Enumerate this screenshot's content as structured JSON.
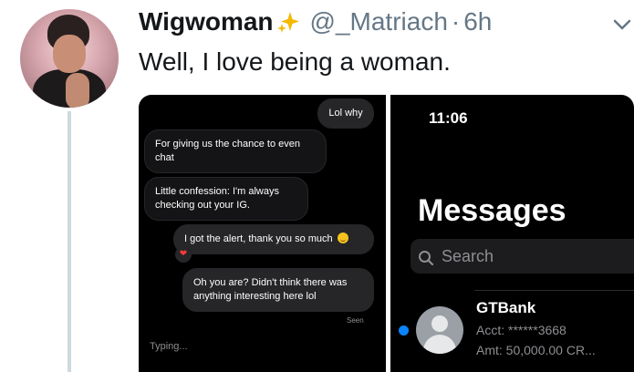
{
  "tweet": {
    "display_name": "Wigwoman",
    "handle": "@_Matriach",
    "separator": "·",
    "time": "6h",
    "text": "Well, I love being a woman."
  },
  "chat_screenshot": {
    "messages": [
      {
        "text": "Lol why",
        "side": "out"
      },
      {
        "text": "For giving us the chance to even chat",
        "side": "in"
      },
      {
        "text": "Little confession:  I'm always checking out your IG.",
        "side": "in"
      },
      {
        "text": "I got the alert, thank you so much",
        "side": "out",
        "emoji": "smile-emoji",
        "reaction": "❤"
      },
      {
        "text": "Oh you are? Didn't think there was anything interesting here lol",
        "side": "out"
      }
    ],
    "seen_label": "Seen",
    "typing_label": "Typing..."
  },
  "messages_screenshot": {
    "status_time": "11:06",
    "title": "Messages",
    "search_placeholder": "Search",
    "conversation": {
      "sender": "GTBank",
      "line1": "Acct: ******3668",
      "line2": "Amt: 50,000.00 CR..."
    }
  },
  "colors": {
    "verified": "#f5b800",
    "thread_line": "#cfd9de",
    "unread": "#0a84ff"
  }
}
